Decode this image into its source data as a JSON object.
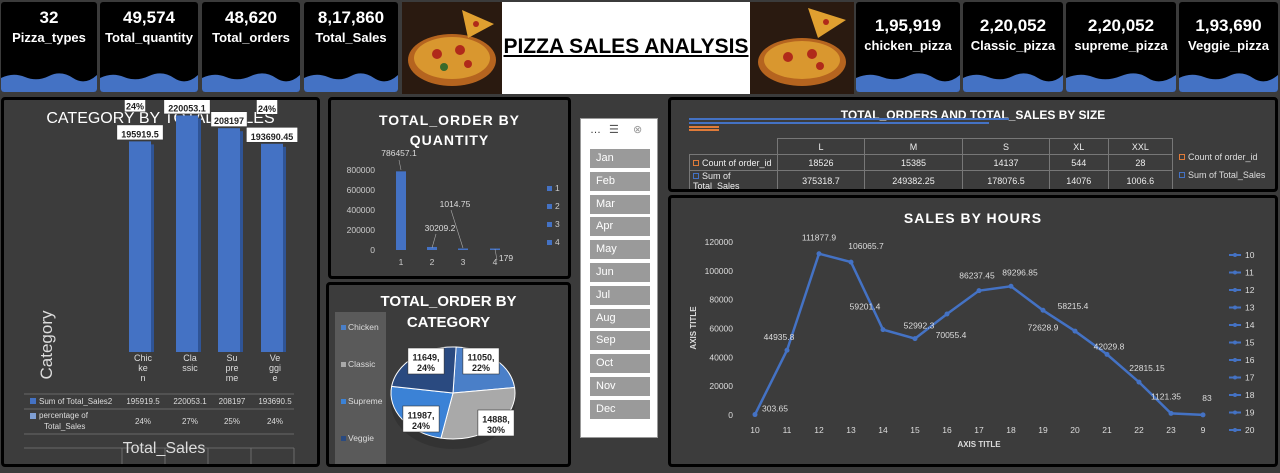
{
  "kpis": [
    {
      "value": "32",
      "label": "Pizza_types"
    },
    {
      "value": "49,574",
      "label": "Total_quantity"
    },
    {
      "value": "48,620",
      "label": "Total_orders"
    },
    {
      "value": "8,17,860",
      "label": "Total_Sales"
    },
    {
      "value": "1,95,919",
      "label": "chicken_pizza"
    },
    {
      "value": "2,20,052",
      "label": "Classic_pizza"
    },
    {
      "value": "2,20,052",
      "label": "supreme_pizza"
    },
    {
      "value": "1,93,690",
      "label": "Veggie_pizza"
    }
  ],
  "header": {
    "title": "PIZZA SALES ANALYSIS"
  },
  "colors": {
    "accent": "#4472c4",
    "panel": "#3c3c3c",
    "border": "#000000"
  },
  "slicer": {
    "icons": [
      "more-icon",
      "multi-select-icon",
      "clear-filter-icon"
    ],
    "months": [
      "Jan",
      "Feb",
      "Mar",
      "Apr",
      "May",
      "Jun",
      "Jul",
      "Aug",
      "Sep",
      "Oct",
      "Nov",
      "Dec"
    ]
  },
  "chart_data": [
    {
      "id": "category",
      "type": "bar",
      "title": "CATEGORY BY TOTAL_SALES",
      "ylabel": "Category",
      "xlabel": "Total_Sales",
      "categories": [
        "Chicken",
        "Classic",
        "Supreme",
        "Veggie"
      ],
      "category_labels": [
        "Chic\nke\nn",
        "Cla\nssic",
        "Su\npre\nme",
        "Ve\nggi\ne"
      ],
      "series": [
        {
          "name": "Sum of Total_Sales2",
          "values": [
            195919.5,
            220053.1,
            208197,
            193690.45
          ],
          "labels": [
            "195919.5",
            "220053.1",
            "208197",
            "193690.45"
          ],
          "table_values": [
            "195919.5",
            "220053.1",
            "208197",
            "193690.5"
          ]
        },
        {
          "name": "percentage of Total_Sales",
          "values": [
            24,
            27,
            25,
            24
          ],
          "labels": [
            "24%",
            "27%",
            "25%",
            "24%"
          ]
        }
      ]
    },
    {
      "id": "quantity",
      "type": "bar",
      "title": "TOTAL_ORDER BY QUANTITY",
      "categories": [
        "1",
        "2",
        "3",
        "4"
      ],
      "values": [
        786457.1,
        30209.2,
        1014.75,
        179
      ],
      "labels": [
        "786457.1",
        "30209.2",
        "1014.75",
        "179"
      ],
      "yticks": [
        "800000",
        "600000",
        "400000",
        "200000",
        "0"
      ],
      "ylim": [
        0,
        900000
      ],
      "legend": [
        "1",
        "2",
        "3",
        "4"
      ]
    },
    {
      "id": "category-pie",
      "type": "pie",
      "title": "TOTAL_ORDER BY CATEGORY",
      "categories": [
        "Chicken",
        "Classic",
        "Supreme",
        "Veggie"
      ],
      "values": [
        11050,
        14888,
        11987,
        11649
      ],
      "labels": [
        "11050,\n22%",
        "14888,\n30%",
        "11987,\n24%",
        "11649,\n24%"
      ],
      "colors": [
        "#4a7fc8",
        "#a9a9a9",
        "#3b82d6",
        "#2a4a80"
      ]
    },
    {
      "id": "size",
      "type": "table",
      "title": "TOTAL_ORDERS AND TOTAL_SALES BY SIZE",
      "columns": [
        "L",
        "M",
        "S",
        "XL",
        "XXL"
      ],
      "rows": [
        {
          "name": "Count of order_id",
          "values": [
            "18526",
            "15385",
            "14137",
            "544",
            "28"
          ]
        },
        {
          "name": "Sum of Total_Sales",
          "values": [
            "375318.7",
            "249382.25",
            "178076.5",
            "14076",
            "1006.6"
          ]
        }
      ],
      "legend": [
        "Count of order_id",
        "Sum of Total_Sales"
      ]
    },
    {
      "id": "hours",
      "type": "line",
      "title": "SALES BY HOURS",
      "xlabel": "AXIS TITLE",
      "ylabel": "AXIS TITLE",
      "x": [
        "10",
        "11",
        "12",
        "13",
        "14",
        "15",
        "16",
        "17",
        "18",
        "19",
        "20",
        "21",
        "22",
        "23",
        "9"
      ],
      "values": [
        303.65,
        44935.8,
        111877.9,
        106065.7,
        59201.4,
        52992.3,
        70055.4,
        86237.45,
        89296.85,
        72628.9,
        58215.4,
        42029.8,
        22815.15,
        1121.35,
        83
      ],
      "labels": [
        "303.65",
        "44935.8",
        "111877.9",
        "106065.7",
        "59201.4",
        "52992.3",
        "70055.4",
        "86237.45",
        "89296.85",
        "72628.9",
        "58215.4",
        "42029.8",
        "22815.15",
        "1121.35",
        "83"
      ],
      "yticks": [
        "0",
        "20000",
        "40000",
        "60000",
        "80000",
        "100000",
        "120000"
      ],
      "ylim": [
        0,
        120000
      ],
      "legend": [
        "10",
        "11",
        "12",
        "13",
        "14",
        "15",
        "16",
        "17",
        "18",
        "19",
        "20"
      ]
    }
  ]
}
